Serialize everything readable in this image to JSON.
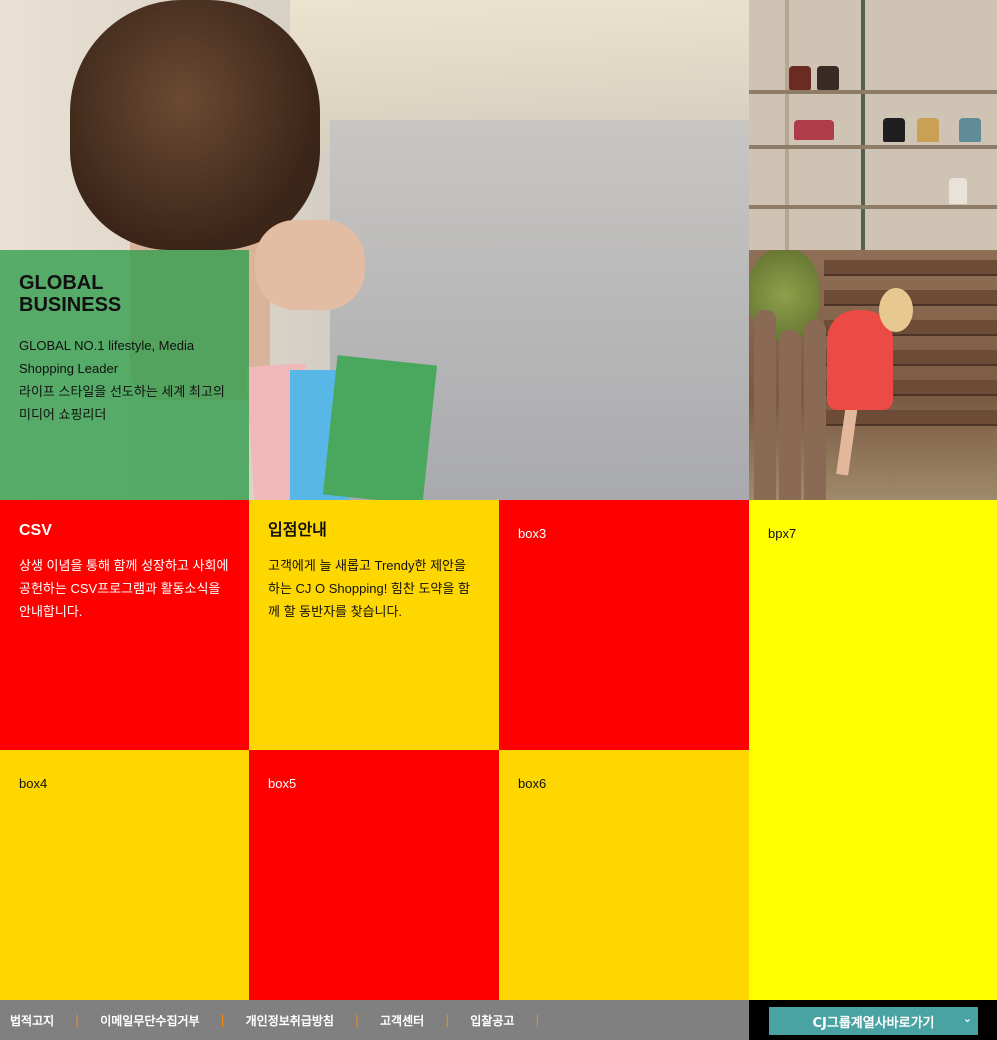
{
  "hero": {
    "title": "GLOBAL BUSINESS",
    "desc": "GLOBAL NO.1 lifestyle, Media Shopping Leader\n라이프 스타일을 선도하는 세계 최고의 미디어 쇼핑리더"
  },
  "boxes": {
    "csv": {
      "title": "CSV",
      "text": "상생 이념을 통해 함께 성장하고 사회에 공헌하는 CSV프로그램과 활동소식을 안내합니다."
    },
    "partner": {
      "title": "입점안내",
      "text": "고객에게 늘 새롭고 Trendy한 제안을 하는 CJ O Shopping! 힘찬 도약을 함께 할 동반자를 찾습니다."
    },
    "box3": "box3",
    "box4": "box4",
    "box5": "box5",
    "box6": "box6",
    "box7": "bpx7"
  },
  "footer": {
    "links": [
      "법적고지",
      "이메일무단수집거부",
      "개인정보취급방침",
      "고객센터",
      "입찰공고"
    ],
    "separator": "|",
    "family_select": "CJ그룹계열사바로가기"
  },
  "colors": {
    "green_overlay": "#36a050",
    "red": "#ff0000",
    "gold": "#ffd700",
    "yellow": "#ffff00",
    "footer_gray": "#808080",
    "separator_orange": "#ff8c00",
    "select_teal": "#4aa3a3"
  }
}
